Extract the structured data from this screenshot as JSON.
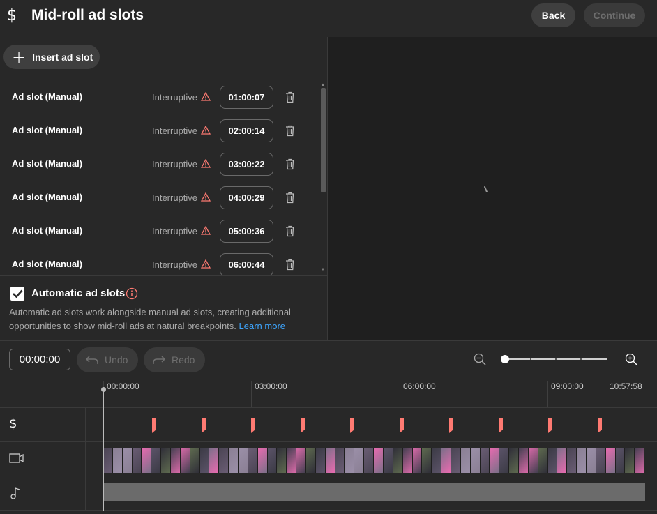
{
  "header": {
    "title": "Mid-roll ad slots",
    "back_label": "Back",
    "continue_label": "Continue"
  },
  "left": {
    "insert_label": "Insert ad slot",
    "slots": [
      {
        "name": "Ad slot (Manual)",
        "type": "Interruptive",
        "time": "01:00:07"
      },
      {
        "name": "Ad slot (Manual)",
        "type": "Interruptive",
        "time": "02:00:14"
      },
      {
        "name": "Ad slot (Manual)",
        "type": "Interruptive",
        "time": "03:00:22"
      },
      {
        "name": "Ad slot (Manual)",
        "type": "Interruptive",
        "time": "04:00:29"
      },
      {
        "name": "Ad slot (Manual)",
        "type": "Interruptive",
        "time": "05:00:36"
      },
      {
        "name": "Ad slot (Manual)",
        "type": "Interruptive",
        "time": "06:00:44"
      }
    ],
    "auto": {
      "checked": true,
      "title": "Automatic ad slots",
      "description": "Automatic ad slots work alongside manual ad slots, creating additional opportunities to show mid-roll ads at natural breakpoints.",
      "link": "Learn more"
    }
  },
  "toolbar": {
    "time": "00:00:00",
    "undo_label": "Undo",
    "redo_label": "Redo",
    "zoom_level": 0
  },
  "timeline": {
    "ruler": [
      "00:00:00",
      "03:00:00",
      "06:00:00",
      "09:00:00",
      "10:57:58"
    ],
    "ad_marker_count": 10,
    "colors": {
      "marker": "#ff7a72",
      "warning": "#ff7a72",
      "link": "#3ea6ff",
      "info": "#ff7a72"
    }
  }
}
